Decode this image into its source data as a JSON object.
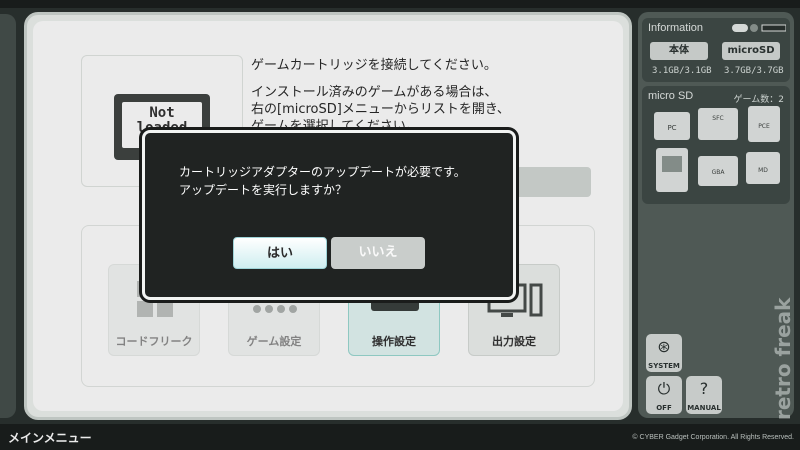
{
  "cartridge": {
    "line1": "Not",
    "line2": "loaded"
  },
  "instructions": {
    "line1": "ゲームカートリッジを接続してください。",
    "line2": "インストール済みのゲームがある場合は、",
    "line3": "右の[microSD]メニューからリストを開き、",
    "line4": "ゲームを選択してください。"
  },
  "menu": {
    "tiles": [
      {
        "label": "コードフリーク",
        "icon": "code-freak-icon"
      },
      {
        "label": "ゲーム設定",
        "icon": "game-settings-icon"
      },
      {
        "label": "操作設定",
        "icon": "controller-settings-icon",
        "active": true
      },
      {
        "label": "出力設定",
        "icon": "output-settings-icon"
      }
    ]
  },
  "info": {
    "title": "Information",
    "main_label": "本体",
    "main_value": "3.1GB/3.1GB",
    "sd_label": "microSD",
    "sd_value": "3.7GB/3.7GB"
  },
  "sd_panel": {
    "title": "micro SD",
    "count": "ゲーム数：2",
    "consoles": [
      "PC",
      "SFC",
      "PCE",
      "MD",
      "GBA",
      "MD"
    ]
  },
  "system": {
    "system_label": "SYSTEM",
    "off_label": "OFF",
    "manual_label": "MANUAL",
    "manual_glyph": "?"
  },
  "brand": "retro freak",
  "footer": {
    "title": "メインメニュー",
    "copyright": "© CYBER Gadget Corporation. All Rights Reserved."
  },
  "dialog": {
    "line1": "カートリッジアダプターのアップデートが必要です。",
    "line2": "アップデートを実行しますか？",
    "yes_label": "はい",
    "no_label": "いいえ"
  },
  "colors": {
    "accent": "#9fd4d8",
    "panel_dark": "#414b48",
    "panel": "#56615d",
    "background": "#2b3230"
  }
}
